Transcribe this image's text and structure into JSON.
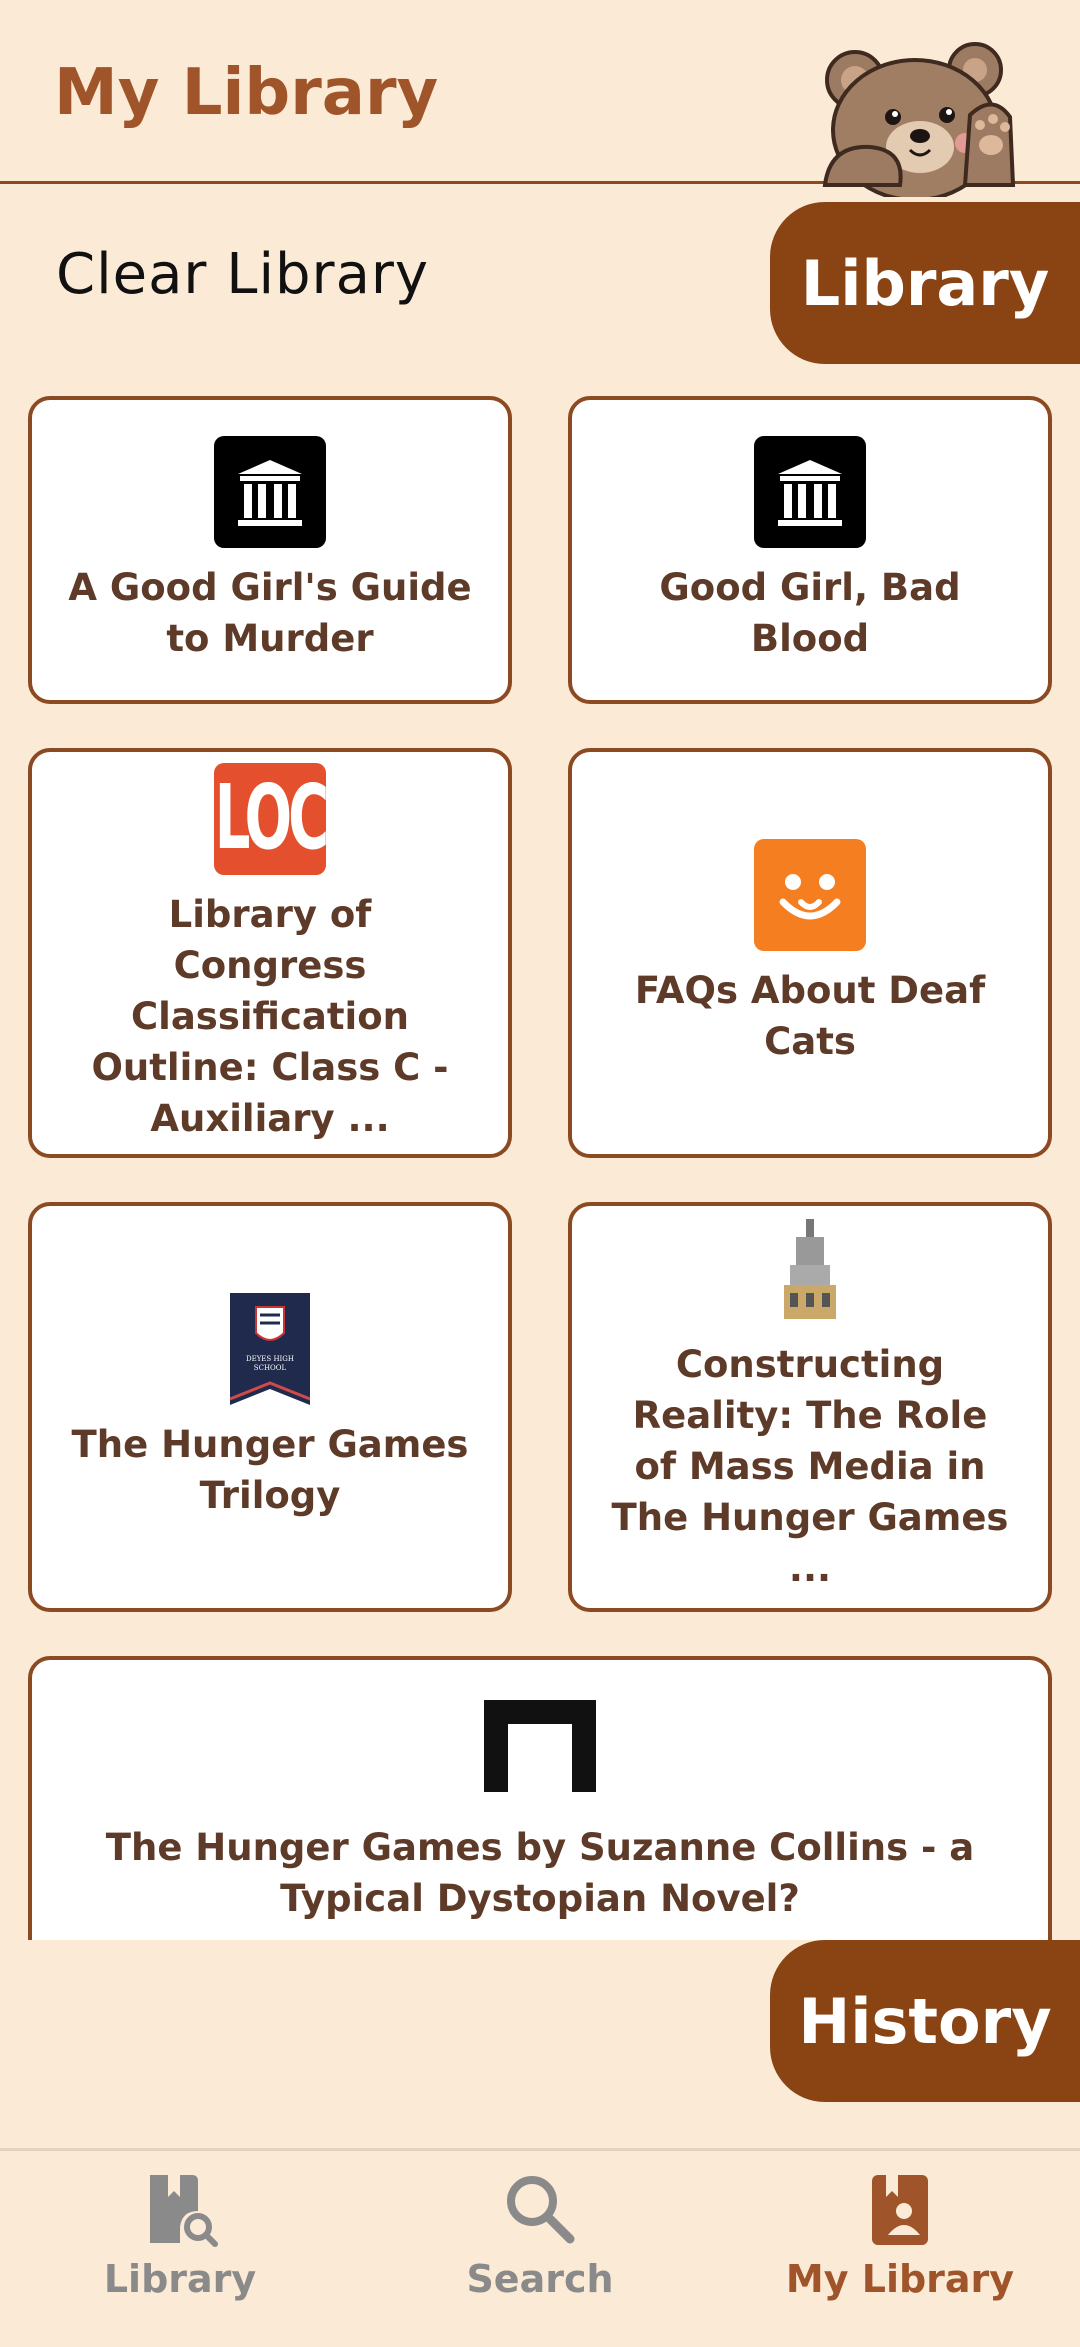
{
  "header": {
    "title": "My Library"
  },
  "actions": {
    "clear_label": "Clear Library",
    "library_label": "Library",
    "history_label": "History"
  },
  "books": [
    {
      "title": "A Good Girl's Guide to Murder",
      "icon": "museum-icon"
    },
    {
      "title": "Good Girl, Bad Blood",
      "icon": "museum-icon"
    },
    {
      "title": "Library of Congress Classification Outline: Class C - Auxiliary ...",
      "icon": "loc-logo-icon",
      "logo_text": "LOC"
    },
    {
      "title": "FAQs About Deaf Cats",
      "icon": "pet-face-icon"
    },
    {
      "title": "The Hunger Games Trilogy",
      "icon": "school-banner-icon",
      "logo_text": "DEYES HIGH SCHOOL"
    },
    {
      "title": "Constructing Reality: The Role of Mass Media in The Hunger Games ...",
      "icon": "building-thumbnail-icon"
    },
    {
      "title": "The Hunger Games by Suzanne Collins - a Typical Dystopian Novel?",
      "icon": "arch-icon"
    }
  ],
  "nav": [
    {
      "label": "Library",
      "icon": "library-search-icon"
    },
    {
      "label": "Search",
      "icon": "search-icon"
    },
    {
      "label": "My Library",
      "icon": "my-library-icon"
    }
  ],
  "colors": {
    "background": "#FBEAD6",
    "accent": "#8A4413",
    "title": "#A0542A",
    "card_border": "#8B4A22"
  }
}
